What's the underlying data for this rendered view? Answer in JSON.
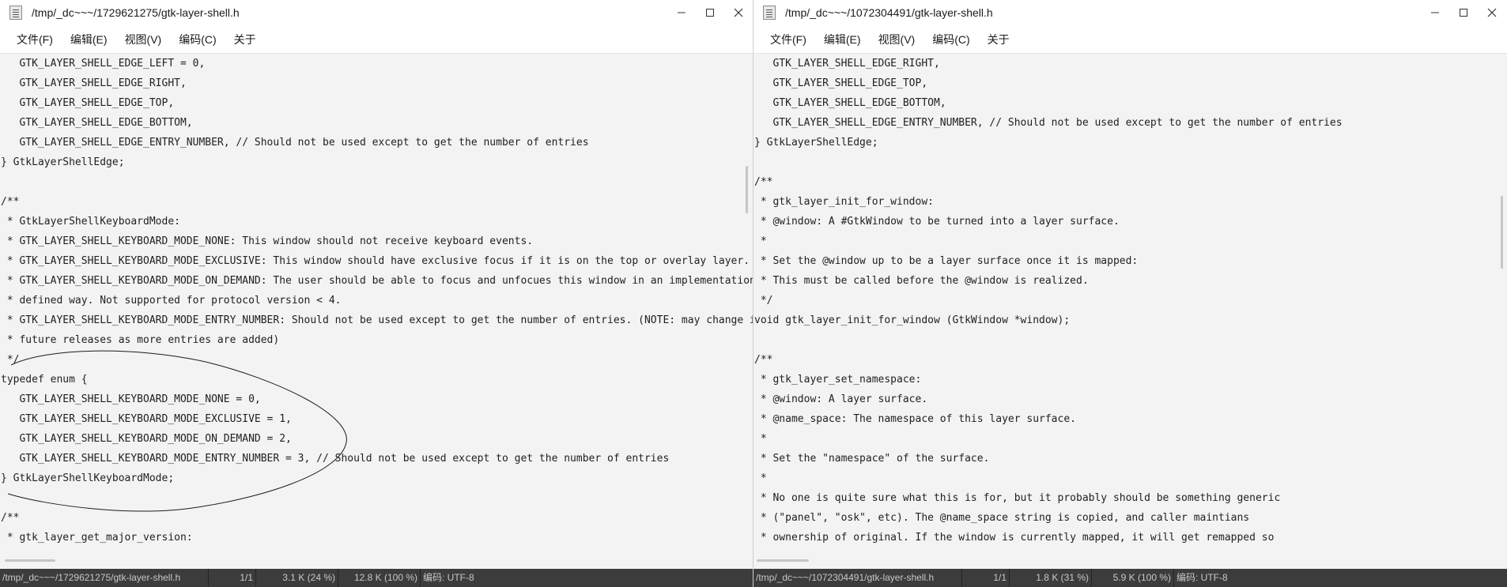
{
  "windows": [
    {
      "title": "/tmp/_dc~~~/1729621275/gtk-layer-shell.h",
      "menus": [
        "文件(F)",
        "编辑(E)",
        "视图(V)",
        "编码(C)",
        "关于"
      ],
      "lines": [
        "   GTK_LAYER_SHELL_EDGE_LEFT = 0,",
        "   GTK_LAYER_SHELL_EDGE_RIGHT,",
        "   GTK_LAYER_SHELL_EDGE_TOP,",
        "   GTK_LAYER_SHELL_EDGE_BOTTOM,",
        "   GTK_LAYER_SHELL_EDGE_ENTRY_NUMBER, // Should not be used except to get the number of entries",
        "} GtkLayerShellEdge;",
        "",
        "/**",
        " * GtkLayerShellKeyboardMode:",
        " * GTK_LAYER_SHELL_KEYBOARD_MODE_NONE: This window should not receive keyboard events.",
        " * GTK_LAYER_SHELL_KEYBOARD_MODE_EXCLUSIVE: This window should have exclusive focus if it is on the top or overlay layer.",
        " * GTK_LAYER_SHELL_KEYBOARD_MODE_ON_DEMAND: The user should be able to focus and unfocues this window in an implementation",
        " * defined way. Not supported for protocol version < 4.",
        " * GTK_LAYER_SHELL_KEYBOARD_MODE_ENTRY_NUMBER: Should not be used except to get the number of entries. (NOTE: may change in",
        " * future releases as more entries are added)",
        " */",
        "typedef enum {",
        "   GTK_LAYER_SHELL_KEYBOARD_MODE_NONE = 0,",
        "   GTK_LAYER_SHELL_KEYBOARD_MODE_EXCLUSIVE = 1,",
        "   GTK_LAYER_SHELL_KEYBOARD_MODE_ON_DEMAND = 2,",
        "   GTK_LAYER_SHELL_KEYBOARD_MODE_ENTRY_NUMBER = 3, // Should not be used except to get the number of entries",
        "} GtkLayerShellKeyboardMode;",
        "",
        "/**",
        " * gtk_layer_get_major_version:"
      ],
      "status": {
        "path": "/tmp/_dc~~~/1729621275/gtk-layer-shell.h",
        "line": "1/1",
        "size": "3.1 K (24 %)",
        "total": "12.8 K (100 %)",
        "encoding": "编码: UTF-8"
      }
    },
    {
      "title": "/tmp/_dc~~~/1072304491/gtk-layer-shell.h",
      "menus": [
        "文件(F)",
        "编辑(E)",
        "视图(V)",
        "编码(C)",
        "关于"
      ],
      "lines": [
        "   GTK_LAYER_SHELL_EDGE_RIGHT,",
        "   GTK_LAYER_SHELL_EDGE_TOP,",
        "   GTK_LAYER_SHELL_EDGE_BOTTOM,",
        "   GTK_LAYER_SHELL_EDGE_ENTRY_NUMBER, // Should not be used except to get the number of entries",
        "} GtkLayerShellEdge;",
        "",
        "/**",
        " * gtk_layer_init_for_window:",
        " * @window: A #GtkWindow to be turned into a layer surface.",
        " *",
        " * Set the @window up to be a layer surface once it is mapped:",
        " * This must be called before the @window is realized.",
        " */",
        "void gtk_layer_init_for_window (GtkWindow *window);",
        "",
        "/**",
        " * gtk_layer_set_namespace:",
        " * @window: A layer surface.",
        " * @name_space: The namespace of this layer surface.",
        " *",
        " * Set the \"namespace\" of the surface.",
        " *",
        " * No one is quite sure what this is for, but it probably should be something generic",
        " * (\"panel\", \"osk\", etc). The @name_space string is copied, and caller maintians",
        " * ownership of original. If the window is currently mapped, it will get remapped so"
      ],
      "status": {
        "path": "/tmp/_dc~~~/1072304491/gtk-layer-shell.h",
        "line": "1/1",
        "size": "1.8 K (31 %)",
        "total": "5.9 K (100 %)",
        "encoding": "编码: UTF-8"
      }
    }
  ]
}
